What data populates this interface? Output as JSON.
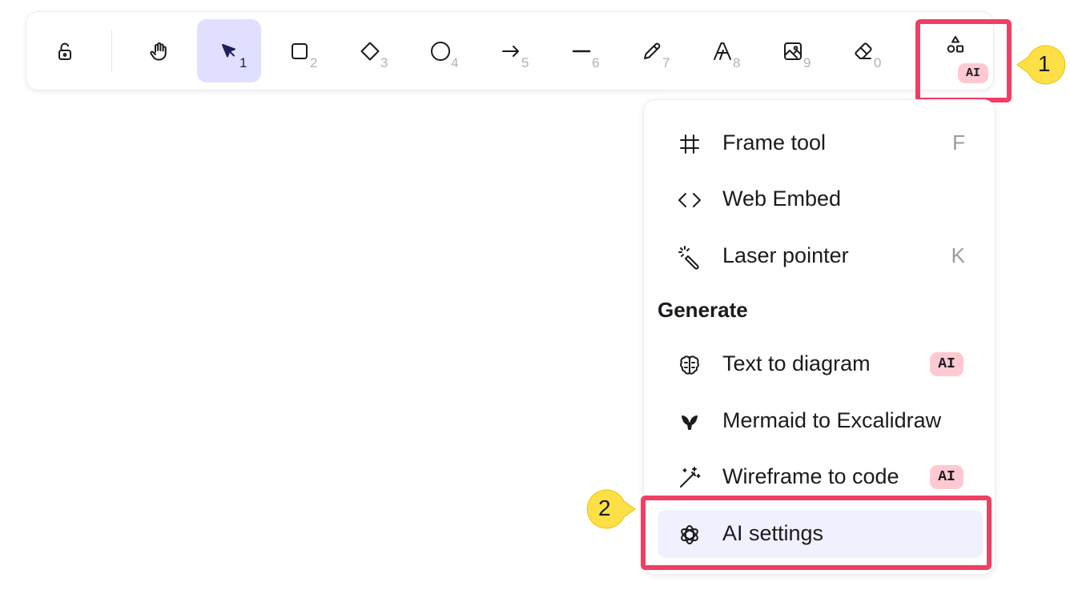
{
  "toolbar": {
    "tools": [
      {
        "name": "lock",
        "key": ""
      },
      {
        "name": "hand",
        "key": ""
      },
      {
        "name": "selection",
        "key": "1",
        "active": true
      },
      {
        "name": "rectangle",
        "key": "2"
      },
      {
        "name": "diamond",
        "key": "3"
      },
      {
        "name": "ellipse",
        "key": "4"
      },
      {
        "name": "arrow",
        "key": "5"
      },
      {
        "name": "line",
        "key": "6"
      },
      {
        "name": "draw",
        "key": "7"
      },
      {
        "name": "text",
        "key": "8"
      },
      {
        "name": "image",
        "key": "9"
      },
      {
        "name": "eraser",
        "key": "0"
      },
      {
        "name": "more-tools",
        "key": ""
      }
    ],
    "more_tools_badge": "AI"
  },
  "menu": {
    "items": [
      {
        "label": "Frame tool",
        "shortcut": "F",
        "icon": "frame-icon"
      },
      {
        "label": "Web Embed",
        "shortcut": "",
        "icon": "embed-icon"
      },
      {
        "label": "Laser pointer",
        "shortcut": "K",
        "icon": "laser-icon"
      }
    ],
    "section_title": "Generate",
    "generate_items": [
      {
        "label": "Text to diagram",
        "badge": "AI",
        "icon": "brain-icon"
      },
      {
        "label": "Mermaid to Excalidraw",
        "badge": "",
        "icon": "mermaid-icon"
      },
      {
        "label": "Wireframe to code",
        "badge": "AI",
        "icon": "magic-wand-icon"
      },
      {
        "label": "AI settings",
        "badge": "",
        "icon": "openai-icon",
        "hovered": true
      }
    ]
  },
  "callouts": {
    "first": "1",
    "second": "2"
  },
  "colors": {
    "highlight": "#f03e64",
    "callout": "#fde047",
    "active_tool": "#e0dfff",
    "ai_badge": "#ffc9d2",
    "menu_hover": "#f1f0ff"
  }
}
